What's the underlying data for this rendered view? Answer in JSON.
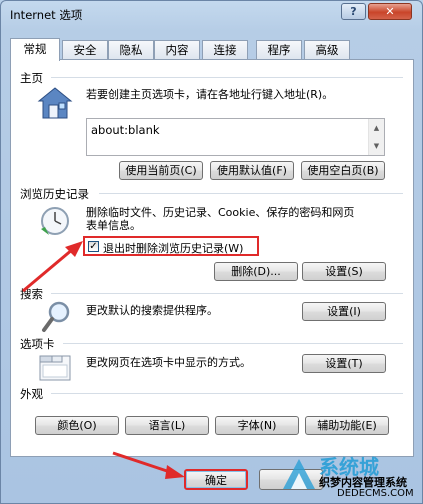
{
  "window": {
    "title": "Internet 选项",
    "help_label": "?",
    "close_label": "✕"
  },
  "tabs": [
    {
      "label": "常规",
      "active": true
    },
    {
      "label": "安全",
      "active": false
    },
    {
      "label": "隐私",
      "active": false
    },
    {
      "label": "内容",
      "active": false
    },
    {
      "label": "连接",
      "active": false
    },
    {
      "label": "程序",
      "active": false
    },
    {
      "label": "高级",
      "active": false
    }
  ],
  "homepage": {
    "heading": "主页",
    "description": "若要创建主页选项卡，请在各地址行键入地址(R)。",
    "address": "about:blank",
    "buttons": {
      "use_current": "使用当前页(C)",
      "use_default": "使用默认值(F)",
      "use_blank": "使用空白页(B)"
    }
  },
  "history": {
    "heading": "浏览历史记录",
    "description_line1": "删除临时文件、历史记录、Cookie、保存的密码和网页",
    "description_line2": "表单信息。",
    "checkbox_label": "退出时删除浏览历史记录(W)",
    "checkbox_checked": true,
    "delete_button": "删除(D)...",
    "settings_button": "设置(S)"
  },
  "search": {
    "heading": "搜索",
    "description": "更改默认的搜索提供程序。",
    "settings_button": "设置(I)"
  },
  "tabbing": {
    "heading": "选项卡",
    "description": "更改网页在选项卡中显示的方式。",
    "settings_button": "设置(T)"
  },
  "appearance": {
    "heading": "外观",
    "buttons": {
      "colors": "颜色(O)",
      "languages": "语言(L)",
      "fonts": "字体(N)",
      "accessibility": "辅助功能(E)"
    }
  },
  "footer": {
    "ok_button": "确定"
  },
  "watermark": {
    "line1": "织梦内容管理系统",
    "line2": "DEDECMS.COM",
    "big": "系统城"
  },
  "colors": {
    "annotation_red": "#e02a2a",
    "title_bg": "#b9d1ea"
  }
}
